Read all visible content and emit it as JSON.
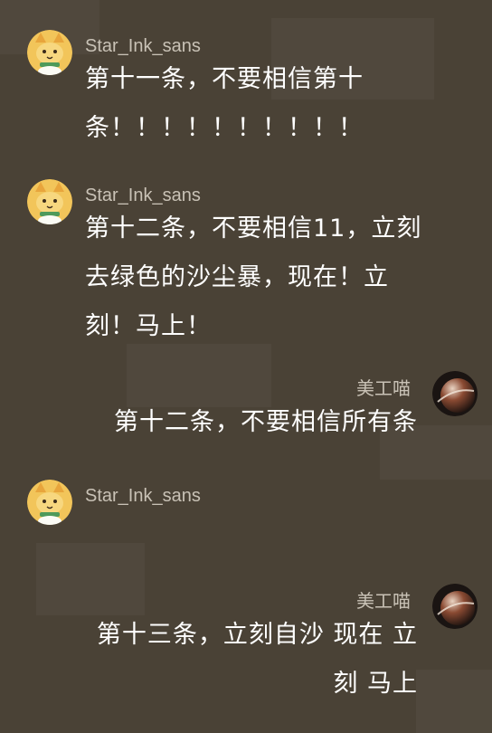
{
  "messages": [
    {
      "side": "in",
      "sender": "Star_Ink_sans",
      "avatar": "cat-avatar",
      "lines": [
        "第十一条，不要相信第十",
        "条！！！！！！！！！！"
      ]
    },
    {
      "side": "in",
      "sender": "Star_Ink_sans",
      "avatar": "cat-avatar",
      "lines": [
        "第十二条，不要相信11，立刻",
        "去绿色的沙尘暴，现在！立",
        "刻！马上！"
      ]
    },
    {
      "side": "out",
      "sender": "美工喵",
      "avatar": "planet-avatar",
      "lines": [
        "第十二条，不要相信所有条"
      ]
    },
    {
      "side": "in",
      "sender": "Star_Ink_sans",
      "avatar": "cat-avatar",
      "lines": []
    },
    {
      "side": "out",
      "sender": "美工喵",
      "avatar": "planet-avatar",
      "lines": [
        "第十三条，立刻自沙 现在 立",
        "刻 马上"
      ]
    }
  ]
}
